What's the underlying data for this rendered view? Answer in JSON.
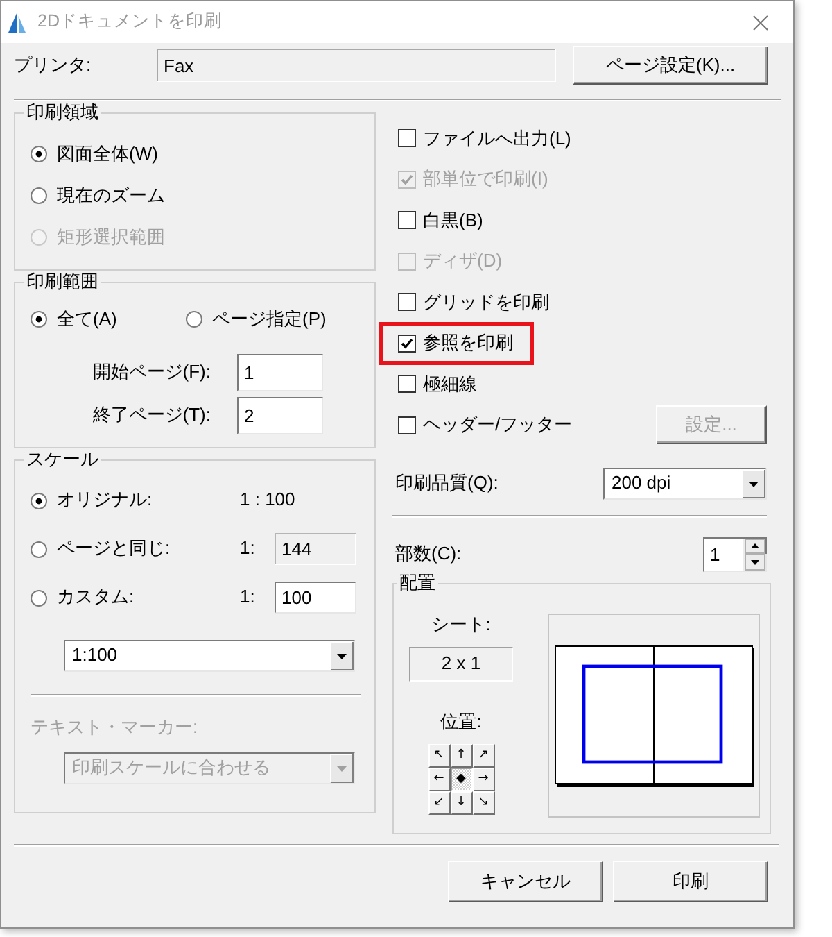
{
  "window": {
    "title": "2Dドキュメントを印刷"
  },
  "printer": {
    "label": "プリンタ:",
    "value": "Fax",
    "button": "ページ設定(K)..."
  },
  "print_area": {
    "title": "印刷領域",
    "options": [
      {
        "label": "図面全体(W)",
        "selected": true,
        "disabled": false
      },
      {
        "label": "現在のズーム",
        "selected": false,
        "disabled": false
      },
      {
        "label": "矩形選択範囲",
        "selected": false,
        "disabled": true
      }
    ]
  },
  "print_range": {
    "title": "印刷範囲",
    "options": [
      {
        "label": "全て(A)",
        "selected": true
      },
      {
        "label": "ページ指定(P)",
        "selected": false
      }
    ],
    "fields": [
      {
        "label": "開始ページ(F):",
        "value": "1"
      },
      {
        "label": "終了ページ(T):",
        "value": "2"
      }
    ]
  },
  "scale": {
    "title": "スケール",
    "options": [
      {
        "kind": "text",
        "label": "オリジナル:",
        "selected": true,
        "value": "1 : 100"
      },
      {
        "kind": "field",
        "label": "ページと同じ:",
        "selected": false,
        "prefix": "1:",
        "value": "144",
        "disabled": true
      },
      {
        "kind": "field",
        "label": "カスタム:",
        "selected": false,
        "prefix": "1:",
        "value": "100",
        "disabled": false
      }
    ],
    "dropdown": {
      "value": "1:100"
    },
    "marker": {
      "label": "テキスト・マーカー:",
      "value": "印刷スケールに合わせる",
      "disabled": true
    }
  },
  "options": [
    {
      "label": "ファイルへ出力(L)",
      "checked": false,
      "disabled": false,
      "highlighted": false
    },
    {
      "label": "部単位で印刷(I)",
      "checked": true,
      "disabled": true,
      "highlighted": false
    },
    {
      "label": "白黒(B)",
      "checked": false,
      "disabled": false,
      "highlighted": false
    },
    {
      "label": "ディザ(D)",
      "checked": false,
      "disabled": true,
      "highlighted": false
    },
    {
      "label": "グリッドを印刷",
      "checked": false,
      "disabled": false,
      "highlighted": false
    },
    {
      "label": "参照を印刷",
      "checked": true,
      "disabled": false,
      "highlighted": true
    },
    {
      "label": "極細線",
      "checked": false,
      "disabled": false,
      "highlighted": false
    },
    {
      "label": "ヘッダー/フッター",
      "checked": false,
      "disabled": false,
      "highlighted": false,
      "button": {
        "label": "設定...",
        "disabled": true
      }
    }
  ],
  "quality": {
    "label": "印刷品質(Q):",
    "value": "200 dpi"
  },
  "copies": {
    "label": "部数(C):",
    "value": "1"
  },
  "layout": {
    "title": "配置",
    "sheet_label": "シート:",
    "sheet_value": "2 x 1",
    "position_label": "位置:",
    "positions": [
      {
        "glyph": "↖",
        "selected": false
      },
      {
        "glyph": "↑",
        "selected": false
      },
      {
        "glyph": "↗",
        "selected": false
      },
      {
        "glyph": "←",
        "selected": false
      },
      {
        "glyph": "◆",
        "selected": true
      },
      {
        "glyph": "→",
        "selected": false
      },
      {
        "glyph": "↙",
        "selected": false
      },
      {
        "glyph": "↓",
        "selected": false
      },
      {
        "glyph": "↘",
        "selected": false
      }
    ]
  },
  "buttons": [
    {
      "label": "キャンセル"
    },
    {
      "label": "印刷"
    }
  ]
}
